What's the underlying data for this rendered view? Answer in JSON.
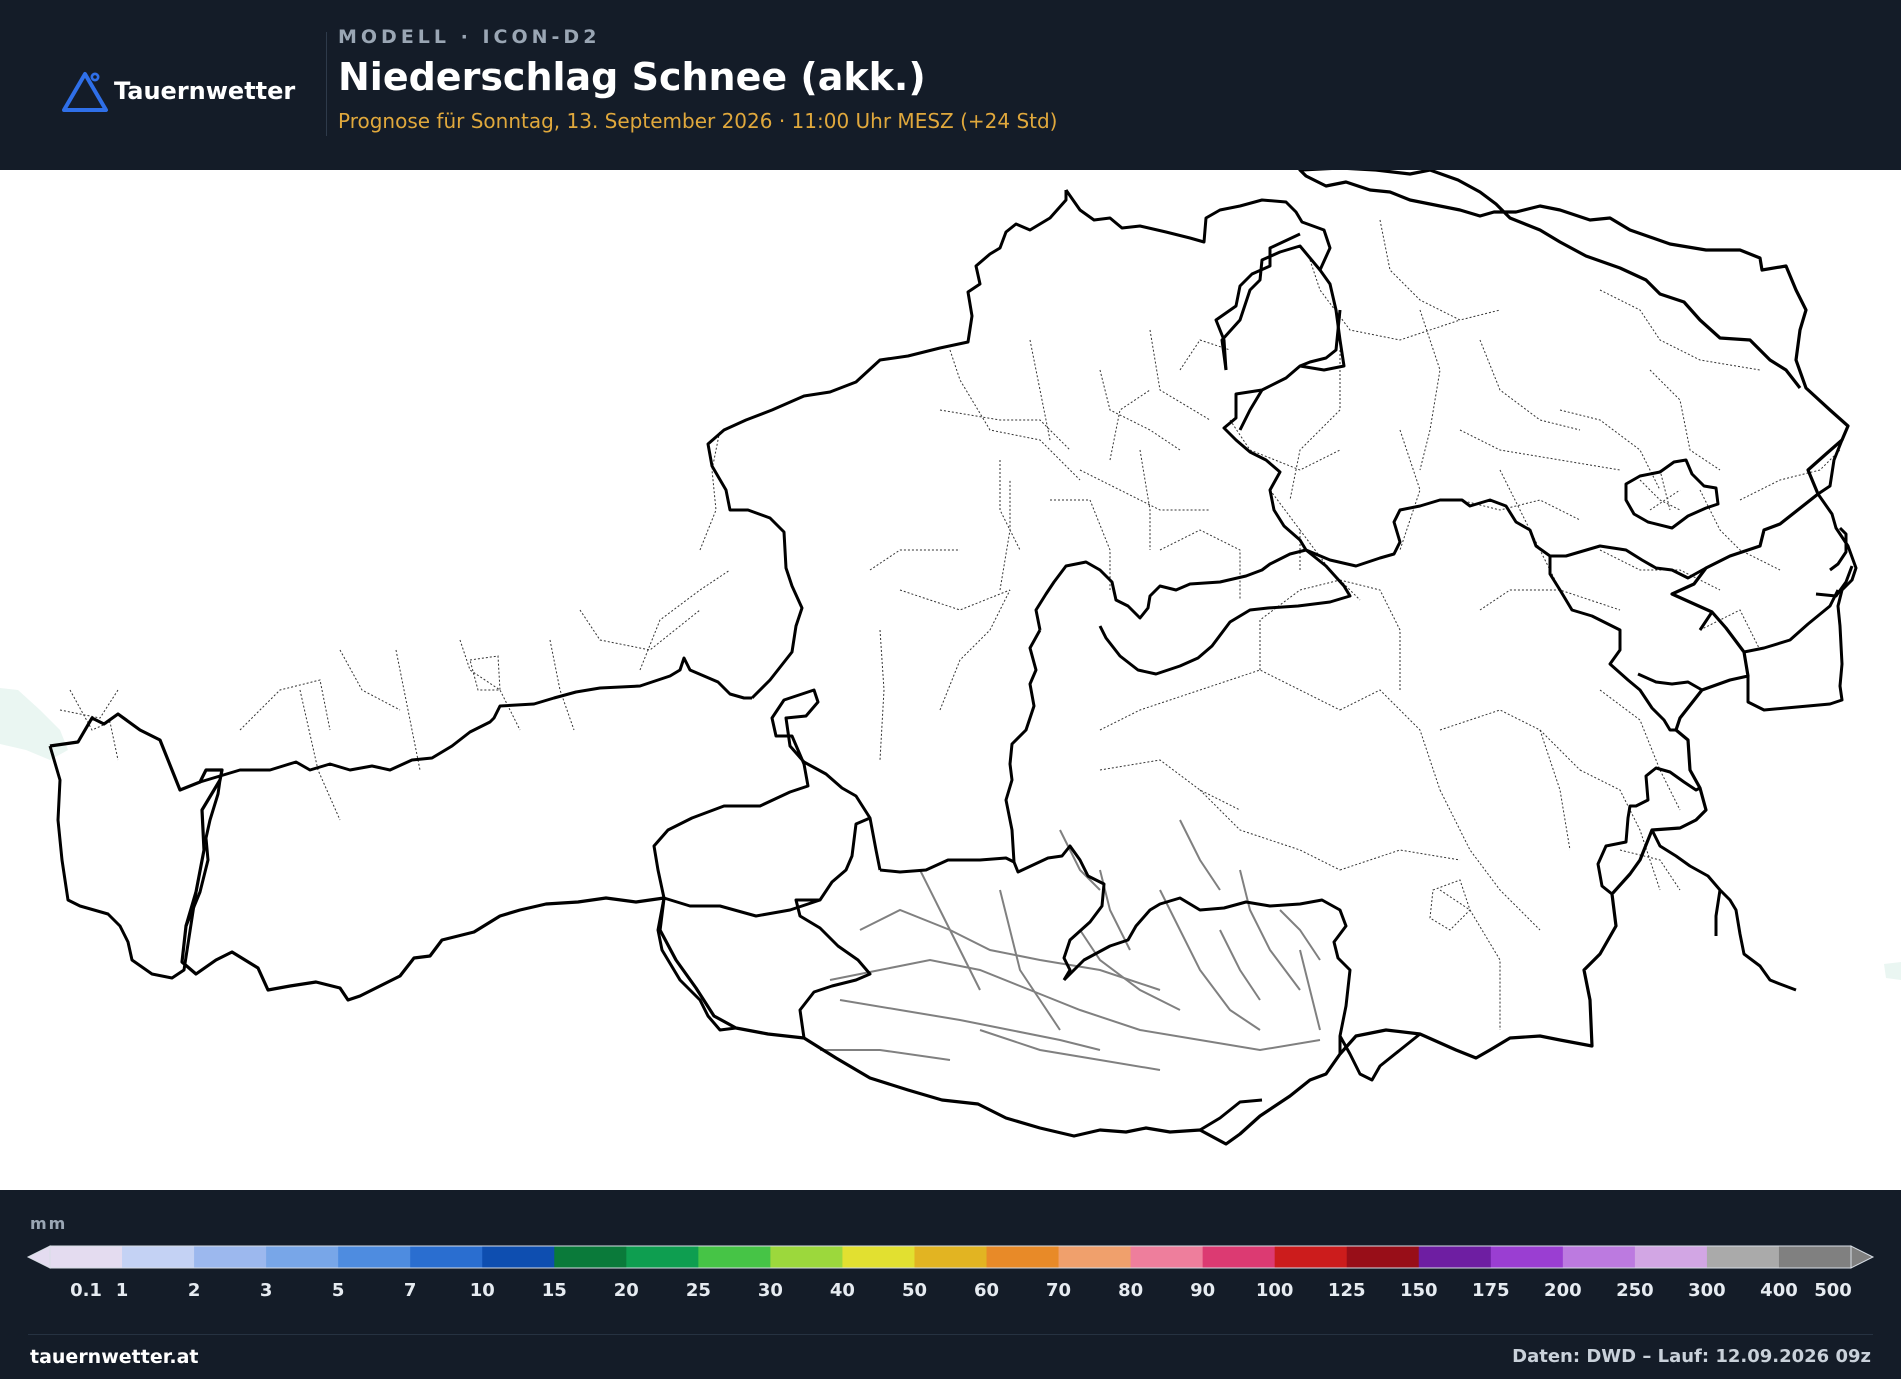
{
  "header": {
    "brand": "Tauernwetter",
    "kicker": "MODELL · ICON-D2",
    "title": "Niederschlag Schnee (akk.)",
    "subtitle": "Prognose für Sonntag, 13. September 2026 · 11:00 Uhr MESZ  (+24 Std)"
  },
  "legend": {
    "unit": "mm",
    "levels": [
      {
        "label": "0.1",
        "color": "#e4dcf0"
      },
      {
        "label": "1",
        "color": "#c4d2f4"
      },
      {
        "label": "2",
        "color": "#9cb8ee"
      },
      {
        "label": "3",
        "color": "#78a6e8"
      },
      {
        "label": "5",
        "color": "#4e8ce0"
      },
      {
        "label": "7",
        "color": "#2a6ed0"
      },
      {
        "label": "10",
        "color": "#0e4eb0"
      },
      {
        "label": "15",
        "color": "#0a7a3a"
      },
      {
        "label": "20",
        "color": "#0e9e50"
      },
      {
        "label": "25",
        "color": "#46c446"
      },
      {
        "label": "30",
        "color": "#9cd83c"
      },
      {
        "label": "40",
        "color": "#e2e030"
      },
      {
        "label": "50",
        "color": "#e2b422"
      },
      {
        "label": "60",
        "color": "#e88a28"
      },
      {
        "label": "70",
        "color": "#f0a06c"
      },
      {
        "label": "80",
        "color": "#ee7e9c"
      },
      {
        "label": "90",
        "color": "#dc3a72"
      },
      {
        "label": "100",
        "color": "#cc1c1c"
      },
      {
        "label": "125",
        "color": "#980e18"
      },
      {
        "label": "150",
        "color": "#6e1ea2"
      },
      {
        "label": "175",
        "color": "#9a3ed2"
      },
      {
        "label": "200",
        "color": "#bc7ae0"
      },
      {
        "label": "250",
        "color": "#d2a6e4"
      },
      {
        "label": "300",
        "color": "#aaaaaa"
      },
      {
        "label": "400",
        "color": "#808080"
      },
      {
        "label": "500",
        "color": ""
      }
    ]
  },
  "footer": {
    "site": "tauernwetter.at",
    "credit": "Daten: DWD – Lauf: 12.09.2026 09z"
  }
}
